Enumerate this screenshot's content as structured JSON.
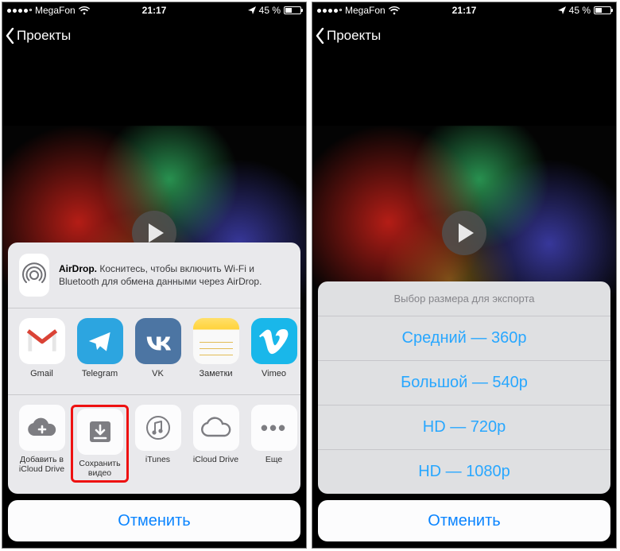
{
  "status": {
    "carrier": "MegaFon",
    "time": "21:17",
    "battery_text": "45 %"
  },
  "nav": {
    "back": "Проекты"
  },
  "share": {
    "airdrop_title": "AirDrop.",
    "airdrop_body": "Коснитесь, чтобы включить Wi-Fi и Bluetooth для обмена данными через AirDrop.",
    "apps": [
      {
        "label": "Gmail"
      },
      {
        "label": "Telegram"
      },
      {
        "label": "VK"
      },
      {
        "label": "Заметки"
      },
      {
        "label": "Vimeo"
      }
    ],
    "actions": [
      {
        "label": "Добавить в iCloud Drive"
      },
      {
        "label": "Сохранить видео"
      },
      {
        "label": "iTunes"
      },
      {
        "label": "iCloud Drive"
      },
      {
        "label": "Еще"
      }
    ],
    "cancel": "Отменить"
  },
  "export": {
    "title": "Выбор размера для экспорта",
    "options": [
      "Средний — 360p",
      "Большой — 540p",
      "HD — 720p",
      "HD — 1080p"
    ],
    "cancel": "Отменить"
  }
}
